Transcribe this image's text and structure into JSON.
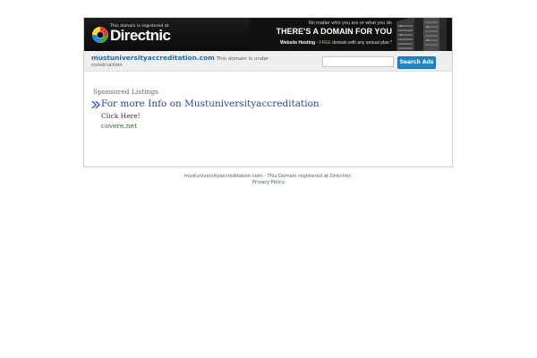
{
  "banner": {
    "registered_note": "This domain is registered at",
    "logo_text": "Directnic",
    "promo_line1": "No matter who you are or what you do",
    "promo_line2": "THERE'S A DOMAIN FOR YOU",
    "promo_hosting": "Website Hosting",
    "promo_sep": " - ",
    "promo_free": "FREE",
    "promo_rest": " domain with any annual plan.*"
  },
  "toolbar": {
    "domain": "mustuniversityaccreditation.com",
    "status": " This domain is under construction",
    "search_placeholder": "",
    "search_button_label": "Search Ads"
  },
  "listings": {
    "heading": "Sponsored Listings",
    "items": [
      {
        "title": "For more Info on Mustuniversityaccreditation",
        "description": "Click Here!",
        "url": "covere.net"
      }
    ]
  },
  "footer": {
    "text": "mustuniversityaccreditation.com - This Domain registered at ",
    "registrar_link": "Directnic",
    "period": ".",
    "privacy_link": "Privacy Policy"
  },
  "colors": {
    "banner_bg": "#111111",
    "link_blue": "#1d6da5",
    "button_blue": "#1e87c9",
    "listing_title": "#2a4a8a",
    "listing_url": "#2a6f2a"
  },
  "icons": {
    "logo": "directnic-logo-icon",
    "rack": "server-rack-icon",
    "arrow": "double-chevron-right-icon"
  }
}
